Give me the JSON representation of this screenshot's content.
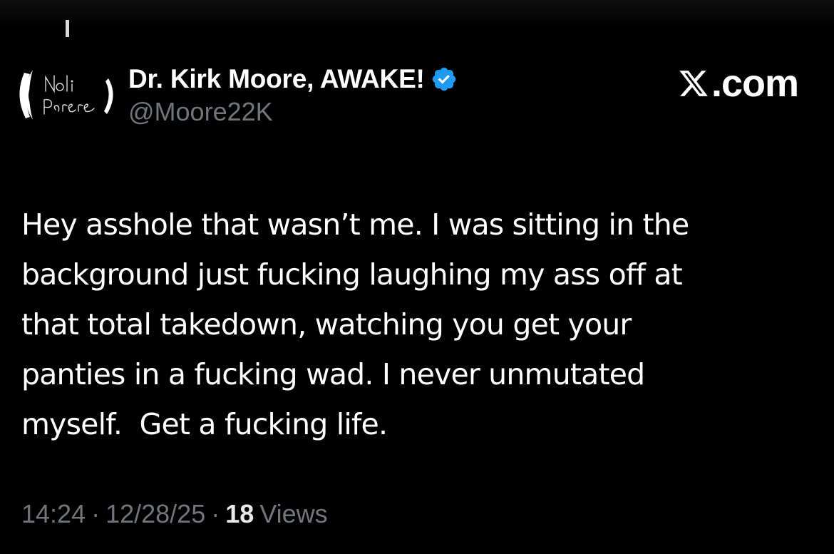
{
  "author": {
    "display_name": "Dr. Kirk Moore, AWAKE!",
    "handle": "@Moore22K",
    "verified": true,
    "avatar_text": "Noli Parere",
    "badge_color": "#1d9bf0"
  },
  "brand": {
    "logo_icon": "x-logo-icon",
    "domain_text": ".com"
  },
  "tweet": {
    "text": "Hey asshole that wasn’t me. I was sitting in the\nbackground just fucking laughing my ass off at\nthat total takedown, watching you get your\npanties in a fucking wad. I never unmutated\nmyself.  Get a fucking life."
  },
  "meta": {
    "time": "14:24",
    "date": "12/28/25",
    "separator": "·",
    "views_count": "18",
    "views_label": "Views"
  },
  "colors": {
    "background": "#000000",
    "text_primary": "#ffffff",
    "text_secondary": "#71767b"
  }
}
